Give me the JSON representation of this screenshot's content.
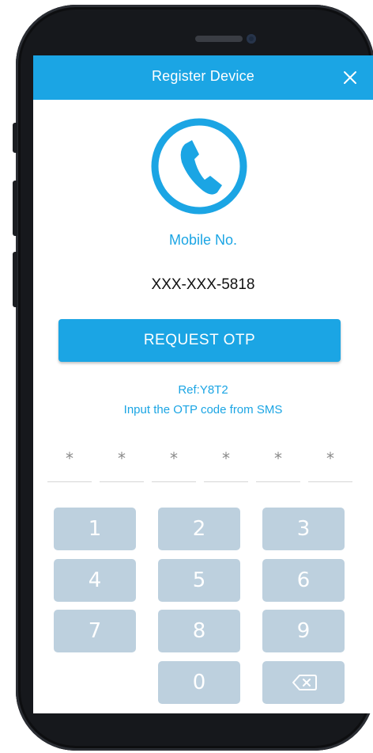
{
  "header": {
    "title": "Register Device",
    "close_icon": "close-icon"
  },
  "main": {
    "icon": "phone-icon",
    "mobile_label": "Mobile No.",
    "mobile_number": "XXX-XXX-5818",
    "request_button": "REQUEST OTP",
    "ref": "Ref:Y8T2",
    "instruction": "Input the OTP code from SMS"
  },
  "otp": {
    "slots": [
      "*",
      "*",
      "*",
      "*",
      "*",
      "*"
    ]
  },
  "keypad": {
    "keys": [
      "1",
      "2",
      "3",
      "4",
      "5",
      "6",
      "7",
      "8",
      "9",
      "0"
    ],
    "backspace_icon": "backspace-icon"
  },
  "colors": {
    "accent": "#1ba5e4",
    "key_bg": "#bdd0de",
    "key_text": "#ffffff"
  }
}
